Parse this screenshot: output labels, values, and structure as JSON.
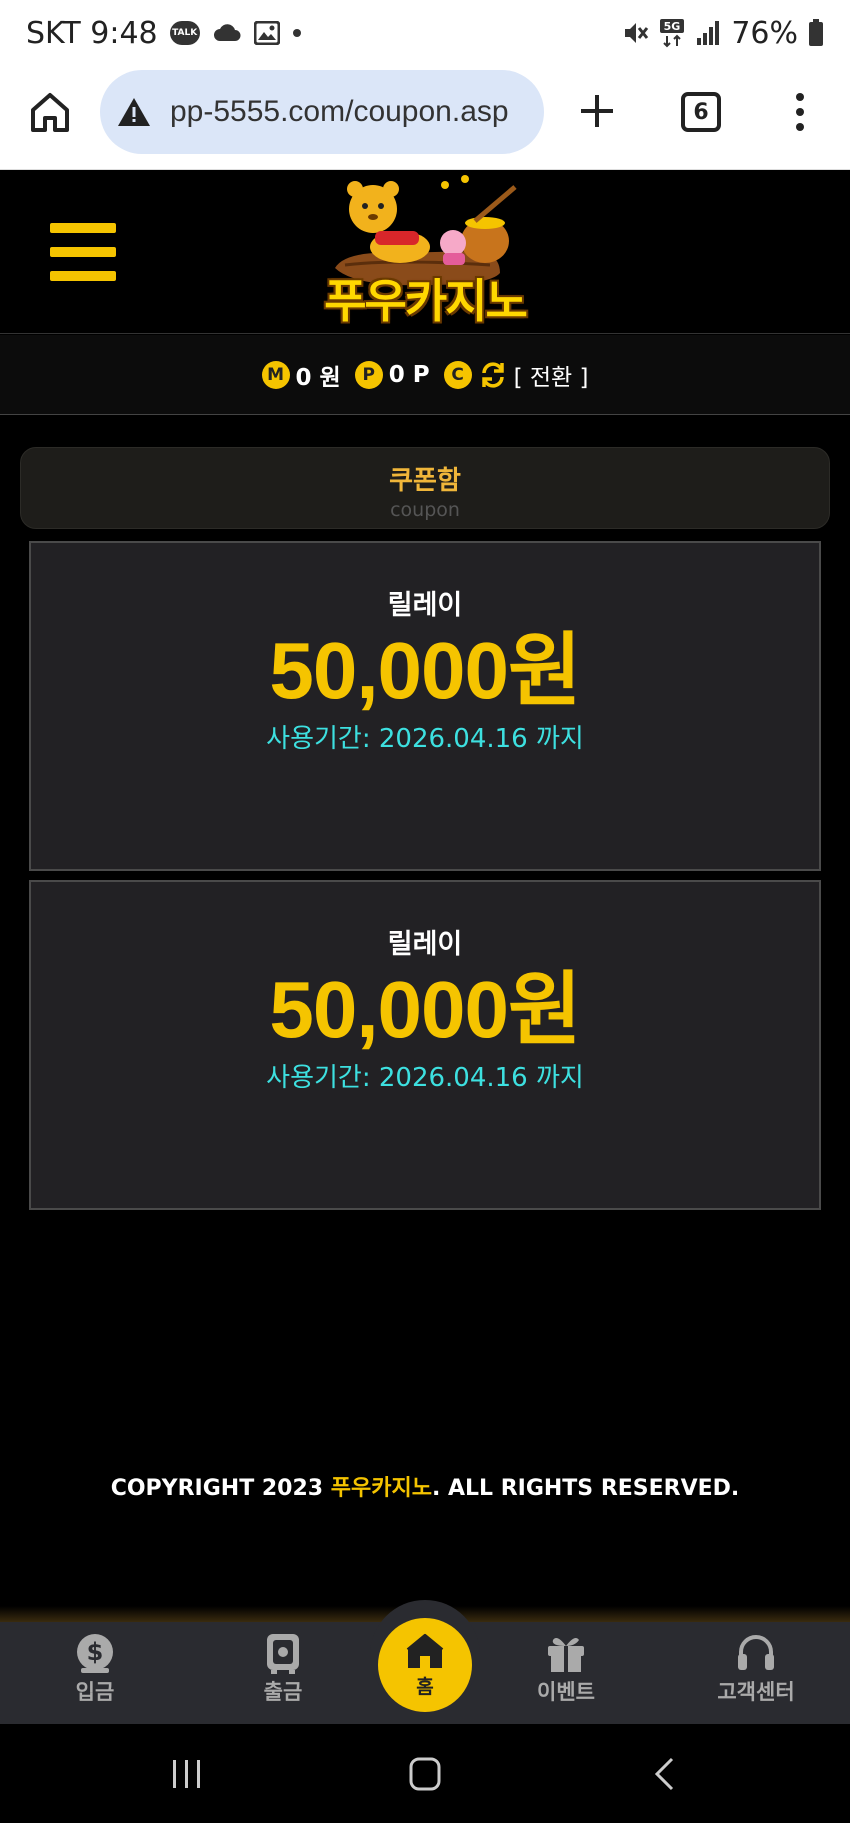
{
  "status_bar": {
    "carrier_time": "SKT 9:48",
    "talk_badge": "TALK",
    "network": "5G",
    "battery": "76%",
    "icons": [
      "kakaotalk-icon",
      "cloud-icon",
      "gallery-icon",
      "mute-icon",
      "signal-icon",
      "battery-icon"
    ]
  },
  "browser": {
    "url": "pp-5555.com/coupon.asp",
    "tab_count": "6",
    "icons": [
      "home-icon",
      "warning-icon",
      "plus-icon",
      "more-icon"
    ]
  },
  "header": {
    "logo_text": "푸우카지노"
  },
  "balance": {
    "money_badge": "M",
    "money_value": "0 원",
    "point_badge": "P",
    "point_value": "0 P",
    "casino_badge": "C",
    "convert_label": "[ 전환 ]"
  },
  "page_title": {
    "korean": "쿠폰함",
    "english": "coupon"
  },
  "coupons": [
    {
      "name": "릴레이",
      "amount": "50,000원",
      "period": "사용기간: 2026.04.16 까지"
    },
    {
      "name": "릴레이",
      "amount": "50,000원",
      "period": "사용기간: 2026.04.16 까지"
    }
  ],
  "footer": {
    "copyright_prefix": "COPYRIGHT 2023 ",
    "copyright_brand": "푸우카지노",
    "copyright_suffix": ". ALL RIGHTS RESERVED."
  },
  "bottom_nav": {
    "deposit": "입금",
    "withdraw": "출금",
    "home": "홈",
    "event": "이벤트",
    "support": "고객센터"
  },
  "colors": {
    "accent": "#f5c400",
    "period_text": "#3de0e0",
    "background": "#000000",
    "card": "#222124"
  }
}
